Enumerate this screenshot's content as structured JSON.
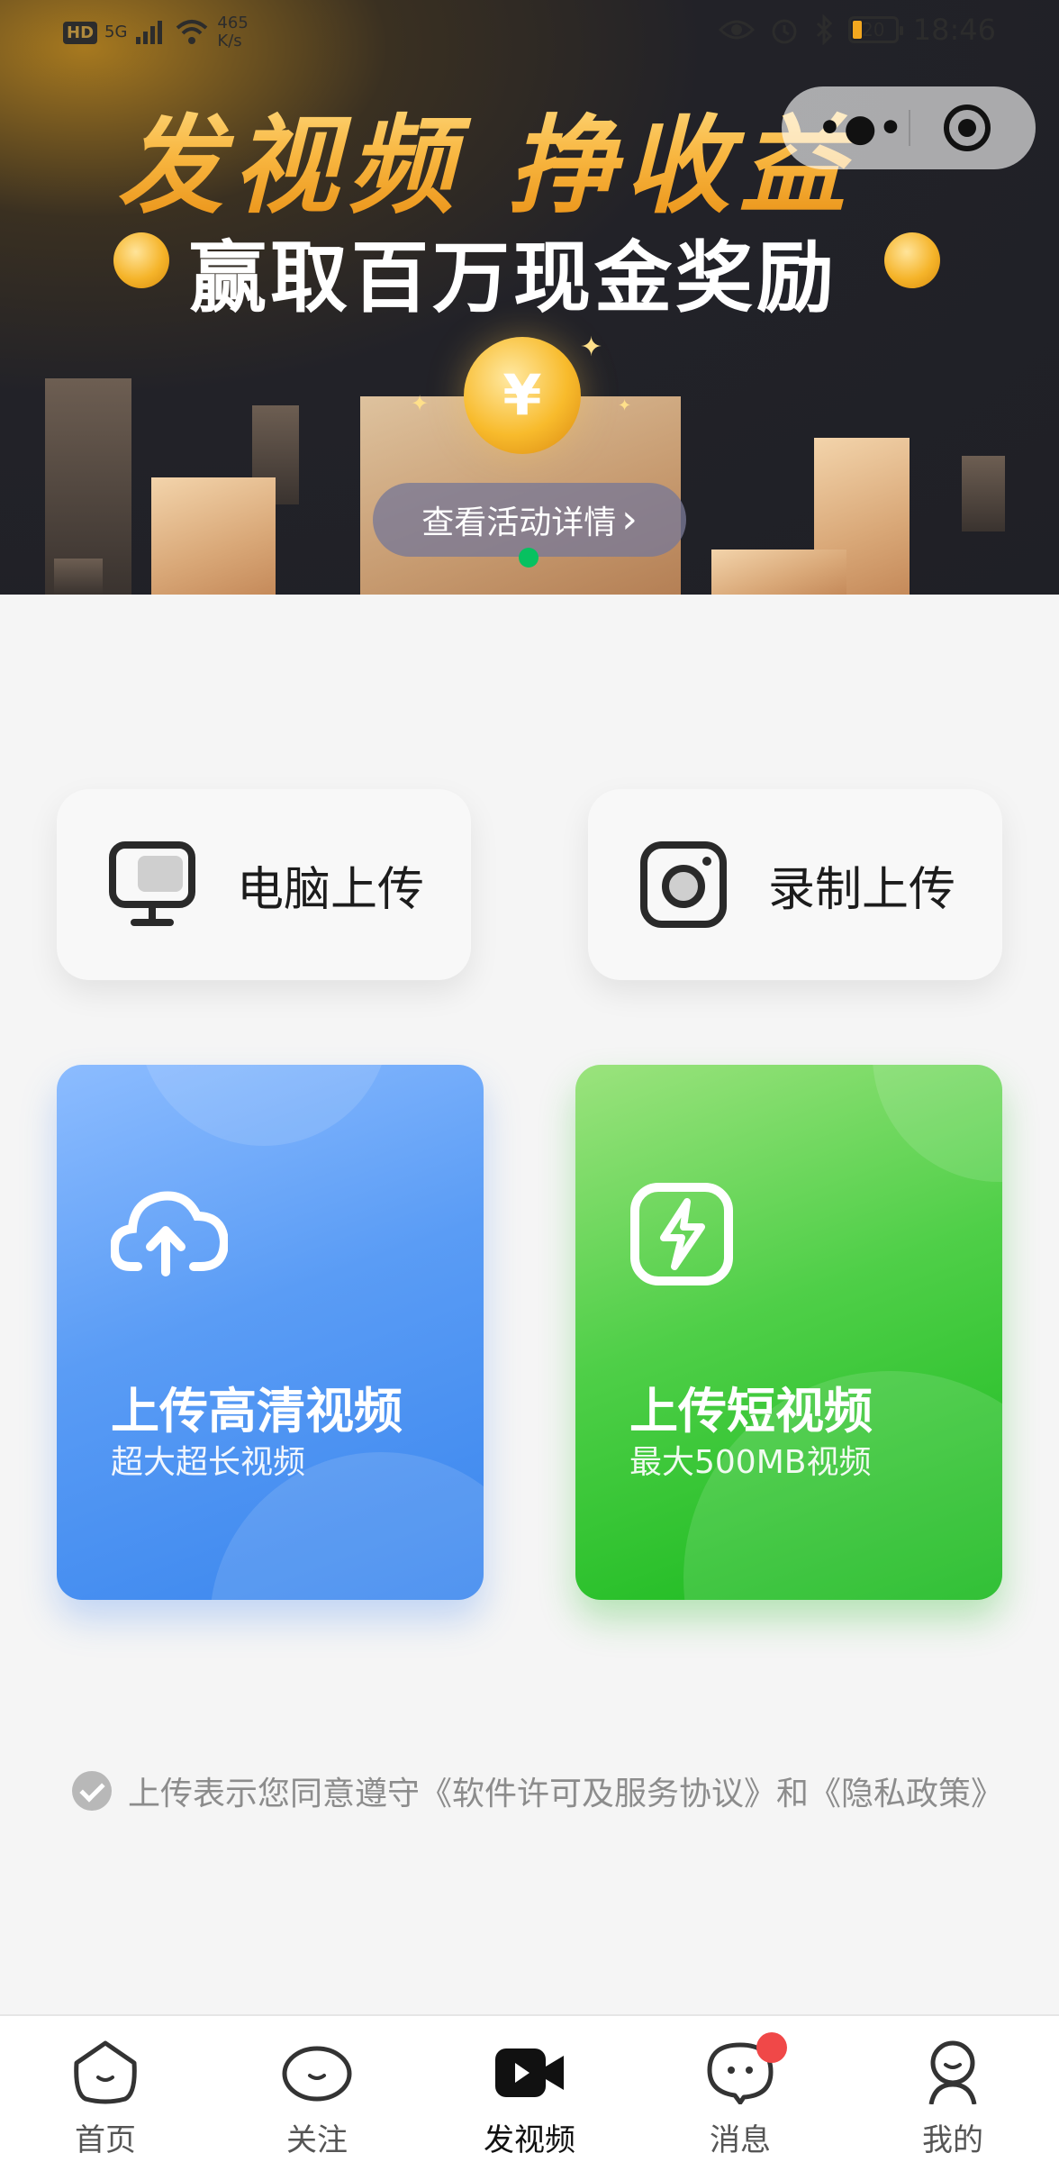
{
  "status_bar": {
    "left_hd": "HD",
    "left_net": "5G",
    "speed_value": "465",
    "speed_unit": "K/s",
    "battery": "20",
    "time": "18:46"
  },
  "banner": {
    "title": "发视频 挣收益",
    "subtitle": "赢取百万现金奖励",
    "coin_symbol": "¥",
    "detail_button": "查看活动详情",
    "detail_chevron": "›"
  },
  "capsule": {
    "more_icon": "more-dots-icon",
    "close_icon": "target-icon"
  },
  "quick_actions": [
    {
      "label": "电脑上传",
      "icon": "monitor-icon"
    },
    {
      "label": "录制上传",
      "icon": "camera-icon"
    }
  ],
  "upload_cards": [
    {
      "title": "上传高清视频",
      "subtitle": "超大超长视频",
      "icon": "cloud-upload-icon"
    },
    {
      "title": "上传短视频",
      "subtitle": "最大500MB视频",
      "icon": "lightning-icon"
    }
  ],
  "agreement": {
    "prefix": "上传表示您同意遵守",
    "license_link": "《软件许可及服务协议》",
    "and": "和",
    "privacy_link": "《隐私政策》"
  },
  "tabs": [
    {
      "label": "首页",
      "icon": "home-face-icon",
      "active": false
    },
    {
      "label": "关注",
      "icon": "follow-face-icon",
      "active": false
    },
    {
      "label": "发视频",
      "icon": "video-camera-icon",
      "active": true
    },
    {
      "label": "消息",
      "icon": "message-icon",
      "active": false,
      "badge": true
    },
    {
      "label": "我的",
      "icon": "profile-icon",
      "active": false
    }
  ],
  "colors": {
    "accent_green": "#07c160",
    "blue_card": "#3a86ee",
    "green_card": "#16b81b",
    "badge_red": "#f04848"
  }
}
